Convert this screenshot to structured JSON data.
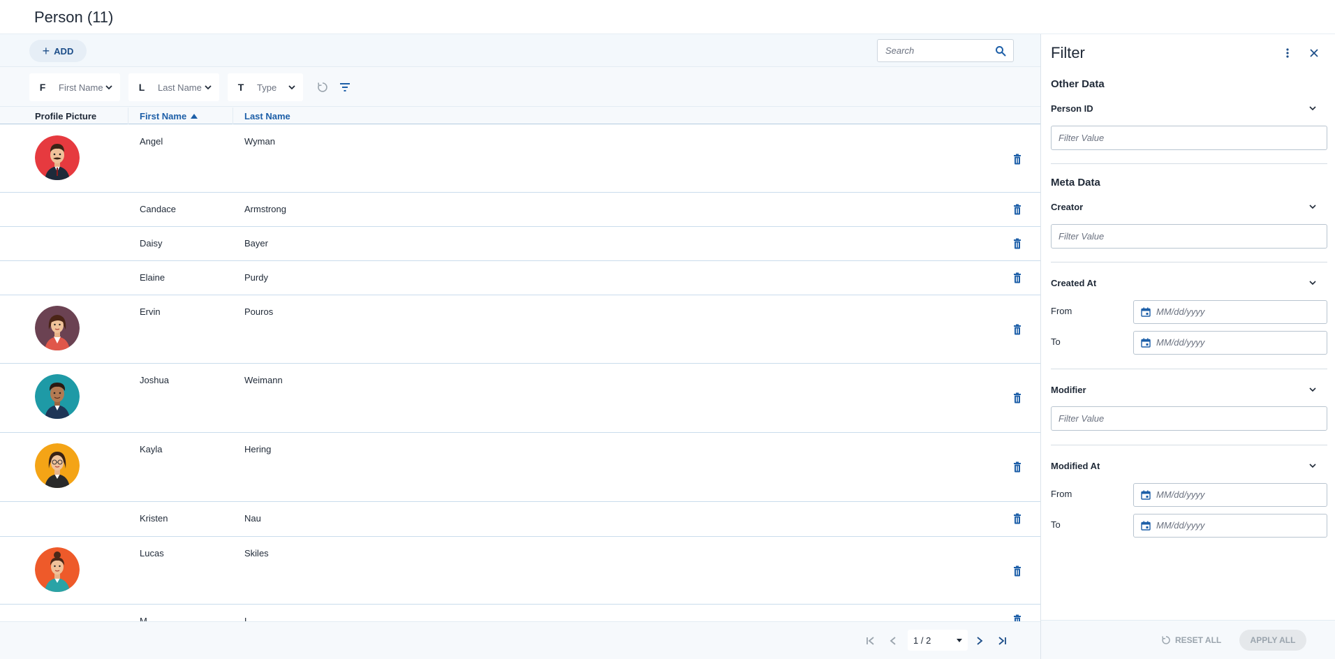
{
  "page": {
    "title": "Person (11)"
  },
  "toolbar": {
    "add_label": "ADD",
    "search_placeholder": "Search"
  },
  "filters": [
    {
      "letter": "F",
      "label": "First Name"
    },
    {
      "letter": "L",
      "label": "Last Name"
    },
    {
      "letter": "T",
      "label": "Type"
    }
  ],
  "table": {
    "columns": [
      "Profile Picture",
      "First Name",
      "Last Name"
    ],
    "rows": [
      {
        "first": "Angel",
        "last": "Wyman",
        "avatar": "man-mustache-avatar"
      },
      {
        "first": "Candace",
        "last": "Armstrong",
        "avatar": ""
      },
      {
        "first": "Daisy",
        "last": "Bayer",
        "avatar": ""
      },
      {
        "first": "Elaine",
        "last": "Purdy",
        "avatar": ""
      },
      {
        "first": "Ervin",
        "last": "Pouros",
        "avatar": "woman-red-jacket-avatar"
      },
      {
        "first": "Joshua",
        "last": "Weimann",
        "avatar": "man-curly-hair-avatar"
      },
      {
        "first": "Kayla",
        "last": "Hering",
        "avatar": "woman-glasses-avatar"
      },
      {
        "first": "Kristen",
        "last": "Nau",
        "avatar": ""
      },
      {
        "first": "Lucas",
        "last": "Skiles",
        "avatar": "woman-bun-avatar"
      },
      {
        "first": "M",
        "last": "L",
        "avatar": ""
      }
    ]
  },
  "pager": {
    "current": "1 / 2"
  },
  "filter_panel": {
    "title": "Filter",
    "sections": {
      "other": "Other Data",
      "meta": "Meta Data"
    },
    "fields": {
      "person_id": "Person ID",
      "creator": "Creator",
      "created_at": "Created At",
      "modifier": "Modifier",
      "modified_at": "Modified At"
    },
    "filter_placeholder": "Filter Value",
    "date_placeholder": "MM/dd/yyyy",
    "from_label": "From",
    "to_label": "To",
    "reset_label": "RESET ALL",
    "apply_label": "APPLY ALL"
  },
  "colors": {
    "accent": "#1d5fa8",
    "trash": "#1d5fa8"
  }
}
